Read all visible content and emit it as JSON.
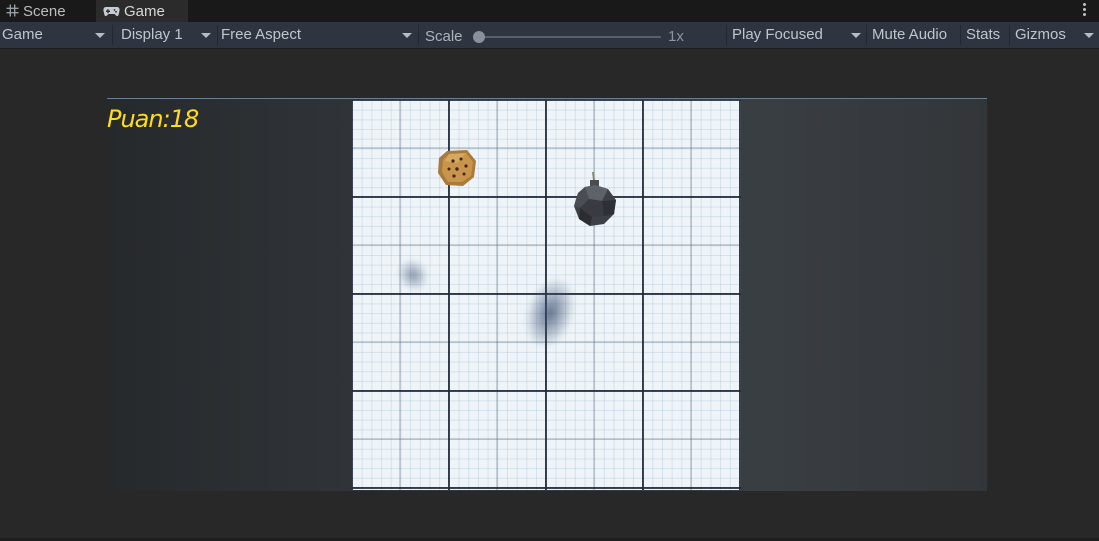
{
  "tabs": [
    {
      "label": "Scene",
      "icon": "grid-icon"
    },
    {
      "label": "Game",
      "icon": "gamepad-icon"
    }
  ],
  "toolbar": {
    "view_mode": "Game",
    "display": "Display 1",
    "aspect": "Free Aspect",
    "scale_label": "Scale",
    "scale_value": "1x",
    "scale_fraction": 0.0,
    "play_mode": "Play Focused",
    "mute_audio": "Mute Audio",
    "stats": "Stats",
    "gizmos": "Gizmos"
  },
  "game": {
    "score_text": "Puan:18",
    "score_color": "#ffdc1a",
    "objects": [
      {
        "type": "cookie",
        "icon": "cookie-icon"
      },
      {
        "type": "bomb",
        "icon": "bomb-icon"
      }
    ]
  }
}
